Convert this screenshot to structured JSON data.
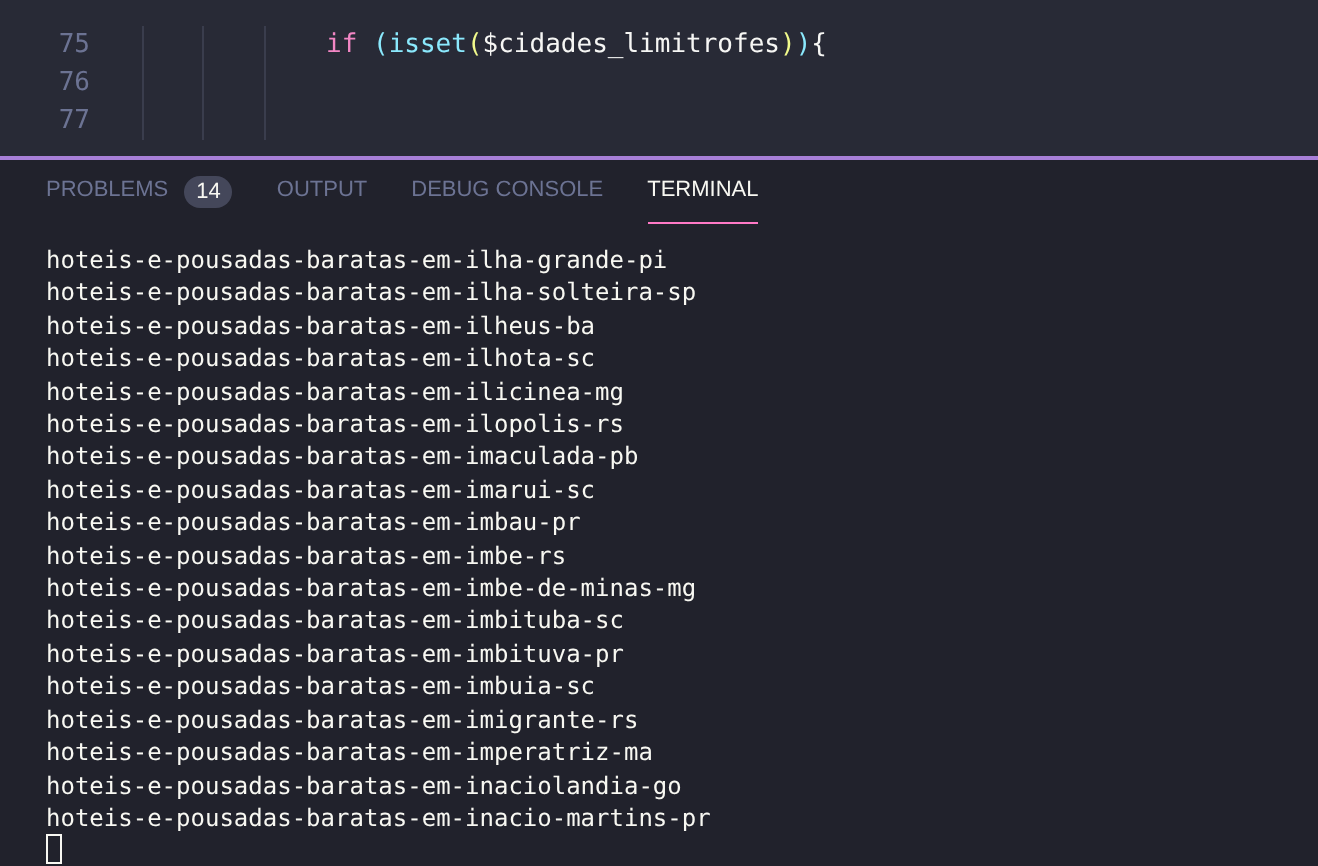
{
  "editor": {
    "lines": [
      {
        "number": "75",
        "tokens": [
          {
            "text": "if",
            "kind": "keyword"
          },
          {
            "text": " (",
            "kind": "bracket1"
          },
          {
            "text": "isset",
            "kind": "function"
          },
          {
            "text": "(",
            "kind": "bracket2"
          },
          {
            "text": "$cidades_limitrofes",
            "kind": "variable"
          },
          {
            "text": ")",
            "kind": "bracket2"
          },
          {
            "text": ")",
            "kind": "bracket1"
          },
          {
            "text": "{",
            "kind": "plain"
          }
        ]
      },
      {
        "number": "76"
      },
      {
        "number": "77"
      }
    ]
  },
  "panel": {
    "tabs": [
      {
        "label": "PROBLEMS",
        "badge": "14",
        "selected": false
      },
      {
        "label": "OUTPUT",
        "selected": false
      },
      {
        "label": "DEBUG CONSOLE",
        "selected": false
      },
      {
        "label": "TERMINAL",
        "selected": true
      }
    ],
    "terminal": {
      "lines": [
        "hoteis-e-pousadas-baratas-em-ilha-grande-pi",
        "hoteis-e-pousadas-baratas-em-ilha-solteira-sp",
        "hoteis-e-pousadas-baratas-em-ilheus-ba",
        "hoteis-e-pousadas-baratas-em-ilhota-sc",
        "hoteis-e-pousadas-baratas-em-ilicinea-mg",
        "hoteis-e-pousadas-baratas-em-ilopolis-rs",
        "hoteis-e-pousadas-baratas-em-imaculada-pb",
        "hoteis-e-pousadas-baratas-em-imarui-sc",
        "hoteis-e-pousadas-baratas-em-imbau-pr",
        "hoteis-e-pousadas-baratas-em-imbe-rs",
        "hoteis-e-pousadas-baratas-em-imbe-de-minas-mg",
        "hoteis-e-pousadas-baratas-em-imbituba-sc",
        "hoteis-e-pousadas-baratas-em-imbituva-pr",
        "hoteis-e-pousadas-baratas-em-imbuia-sc",
        "hoteis-e-pousadas-baratas-em-imigrante-rs",
        "hoteis-e-pousadas-baratas-em-imperatriz-ma",
        "hoteis-e-pousadas-baratas-em-inaciolandia-go",
        "hoteis-e-pousadas-baratas-em-inacio-martins-pr"
      ]
    }
  }
}
